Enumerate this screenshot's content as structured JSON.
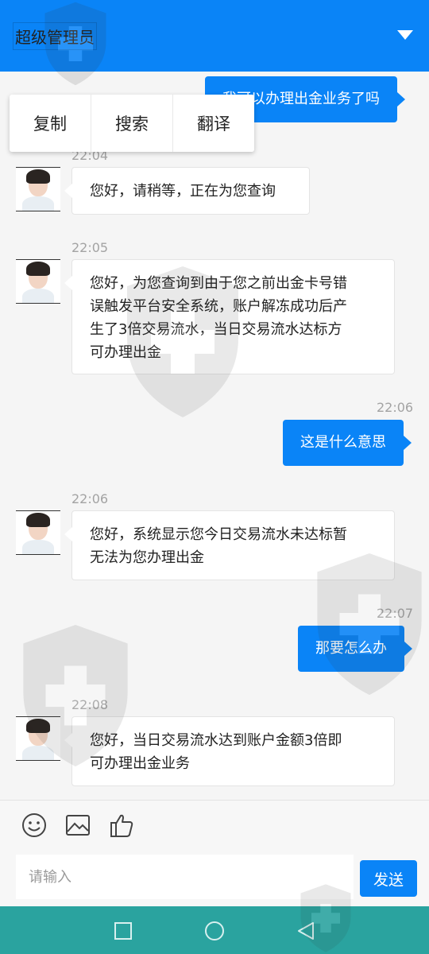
{
  "header": {
    "title": "超级管理员"
  },
  "context_menu": {
    "items": [
      "复制",
      "搜索",
      "翻译"
    ]
  },
  "messages": [
    {
      "side": "right",
      "text": "我可以办理出金业务了吗"
    },
    {
      "side": "left",
      "time": "22:04",
      "text": "您好，请稍等，正在为您查询"
    },
    {
      "side": "left",
      "time": "22:05",
      "lines": [
        "您好，为您查询到由于您之前出金卡号错",
        "误触发平台安全系统，账户解冻成功后产",
        "生了3倍交易流水，当日交易流水达标方",
        "可办理出金"
      ]
    },
    {
      "side": "right",
      "time": "22:06",
      "text": "这是什么意思"
    },
    {
      "side": "left",
      "time": "22:06",
      "lines": [
        "您好，系统显示您今日交易流水未达标暂",
        "无法为您办理出金"
      ]
    },
    {
      "side": "right",
      "time": "22:07",
      "text": "那要怎么办"
    },
    {
      "side": "left",
      "time": "22:08",
      "lines": [
        "您好，当日交易流水达到账户金额3倍即",
        "可办理出金业务"
      ]
    }
  ],
  "toolbar": {
    "icons": [
      "emoji-icon",
      "image-icon",
      "thumbs-up-icon"
    ],
    "input_placeholder": "请输入",
    "send_label": "发送"
  },
  "navbar": {
    "buttons": [
      "recent-apps-button",
      "home-button",
      "back-button"
    ]
  },
  "colors": {
    "accent": "#0a84f7",
    "navbar": "#2aa39f",
    "background": "#f5f5f5"
  }
}
